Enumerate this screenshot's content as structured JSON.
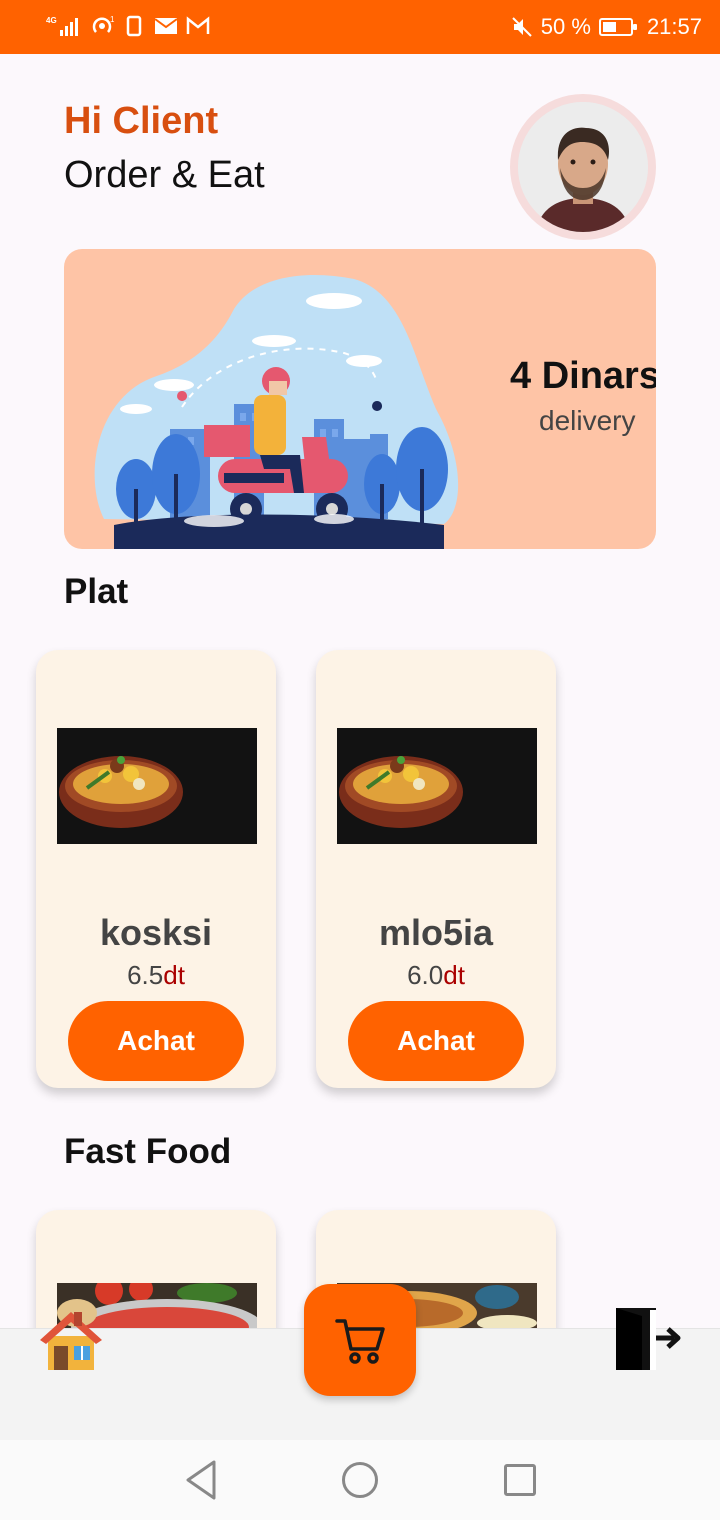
{
  "status_bar": {
    "network": "4G",
    "battery_text": "50 %",
    "battery_level_pct": 50,
    "time": "21:57"
  },
  "header": {
    "greeting": "Hi Client",
    "tagline": "Order & Eat"
  },
  "banner": {
    "price": "4 Dinars",
    "label": "delivery"
  },
  "sections": [
    {
      "title": "Plat",
      "items": [
        {
          "name": "kosksi",
          "price": "6.5",
          "currency": "dt",
          "button": "Achat"
        },
        {
          "name": "mlo5ia",
          "price": "6.0",
          "currency": "dt",
          "button": "Achat"
        }
      ]
    },
    {
      "title": "Fast Food",
      "items": [
        {},
        {}
      ]
    }
  ],
  "bottom_nav": {
    "home_icon": "home-icon",
    "cart_icon": "cart-icon",
    "logout_icon": "logout-icon"
  },
  "colors": {
    "accent": "#ff6200",
    "greeting": "#d84f10",
    "banner_bg": "#fec4a6",
    "card_bg": "#fdf3e6"
  }
}
